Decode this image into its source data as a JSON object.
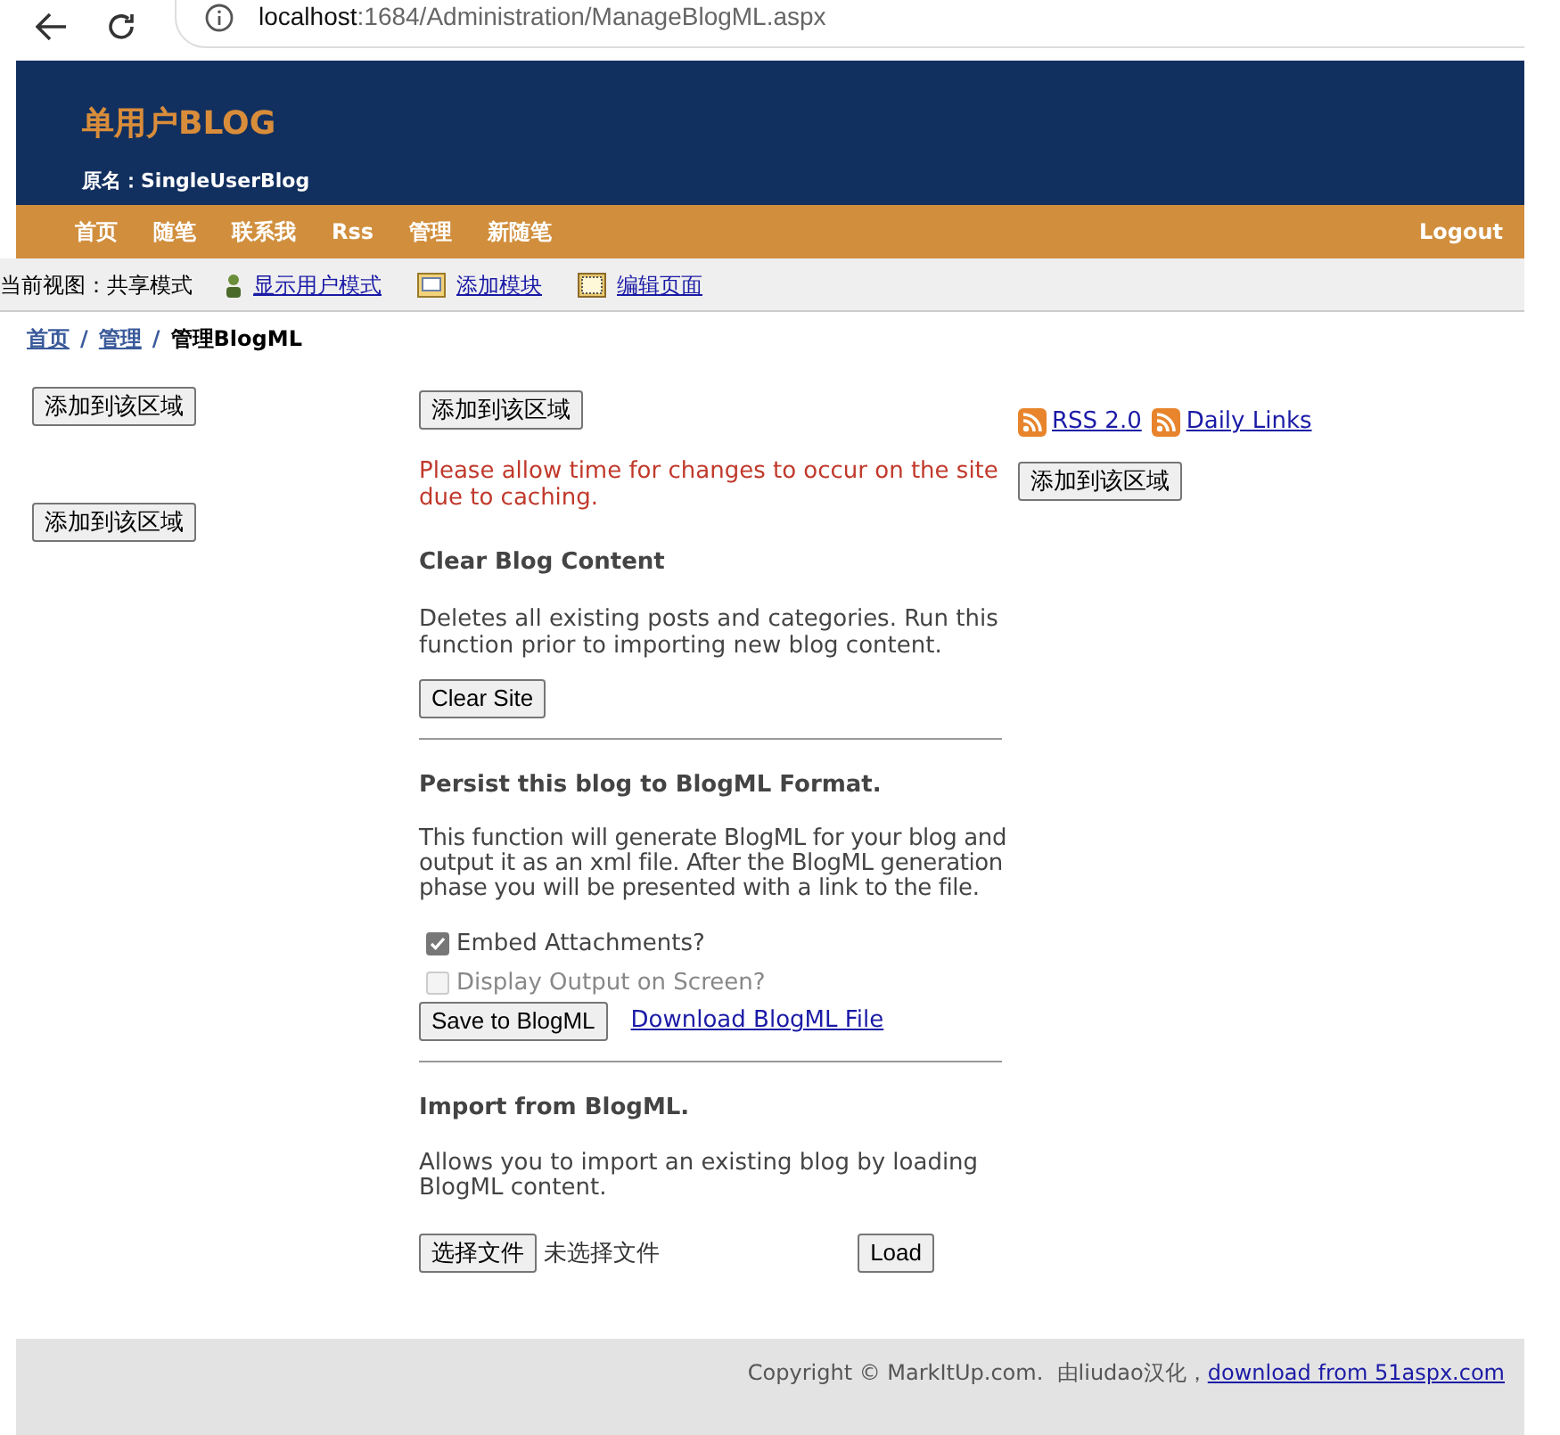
{
  "browser": {
    "host": "localhost",
    "path": ":1684/Administration/ManageBlogML.aspx"
  },
  "header": {
    "title": "单用户BLOG",
    "subtitle": "原名：SingleUserBlog"
  },
  "nav": {
    "items": [
      "首页",
      "随笔",
      "联系我",
      "Rss",
      "管理",
      "新随笔"
    ],
    "logout": "Logout"
  },
  "toolbar": {
    "view_label": "当前视图：共享模式",
    "links": [
      {
        "kind": "user",
        "label": "显示用户模式"
      },
      {
        "kind": "module",
        "label": "添加模块"
      },
      {
        "kind": "page",
        "label": "编辑页面"
      }
    ]
  },
  "breadcrumb": {
    "links": [
      "首页",
      "管理"
    ],
    "separator": "/",
    "current": "管理BlogML"
  },
  "left_column": {
    "buttons": [
      "添加到该区域",
      "添加到该区域"
    ]
  },
  "main": {
    "add_button": "添加到该区域",
    "notice": "Please allow time for changes to occur on the site due to caching.",
    "clear": {
      "heading": "Clear Blog Content",
      "text": "Deletes all existing posts and categories. Run this function prior to importing new blog content.",
      "button": "Clear Site"
    },
    "persist": {
      "heading": "Persist this blog to BlogML Format.",
      "text": "This function will generate BlogML for your blog and output it as an xml file. After the BlogML generation phase you will be presented with a link to the file.",
      "options": [
        {
          "label": "Embed Attachments?",
          "checked": true,
          "disabled": false
        },
        {
          "label": "Display Output on Screen?",
          "checked": false,
          "disabled": true
        }
      ],
      "button": "Save to BlogML",
      "link": "Download BlogML File"
    },
    "import": {
      "heading": "Import from BlogML.",
      "text": "Allows you to import an existing blog by loading BlogML content.",
      "file_button": "选择文件",
      "file_status": "未选择文件",
      "button": "Load"
    }
  },
  "right_column": {
    "feeds": [
      "RSS 2.0",
      "Daily Links"
    ],
    "add_button": "添加到该区域"
  },
  "footer": {
    "copyright": "Copyright © MarkItUp.com.  由liudao汉化，",
    "link": "download from 51aspx.com"
  }
}
